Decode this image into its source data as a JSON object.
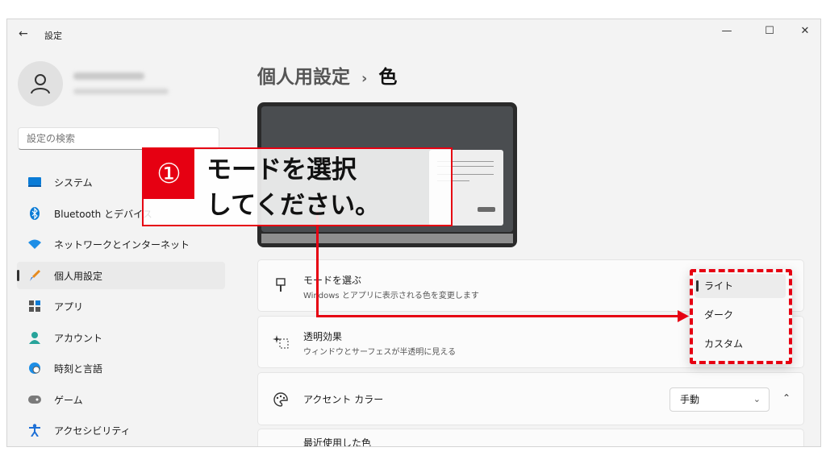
{
  "window": {
    "title": "設定",
    "back_icon": "←",
    "minimize": "—",
    "maximize": "☐",
    "close": "✕"
  },
  "user": {
    "avatar_icon": "person-icon"
  },
  "search": {
    "placeholder": "設定の検索"
  },
  "sidebar": {
    "items": [
      {
        "label": "システム",
        "icon": "monitor-icon"
      },
      {
        "label": "Bluetooth とデバイス",
        "icon": "bluetooth-icon"
      },
      {
        "label": "ネットワークとインターネット",
        "icon": "wifi-icon"
      },
      {
        "label": "個人用設定",
        "icon": "brush-icon",
        "active": true
      },
      {
        "label": "アプリ",
        "icon": "apps-icon"
      },
      {
        "label": "アカウント",
        "icon": "account-icon"
      },
      {
        "label": "時刻と言語",
        "icon": "globe-clock-icon"
      },
      {
        "label": "ゲーム",
        "icon": "gamepad-icon"
      },
      {
        "label": "アクセシビリティ",
        "icon": "accessibility-icon"
      }
    ]
  },
  "header": {
    "parent": "個人用設定",
    "separator": "›",
    "current": "色"
  },
  "mode_card": {
    "title": "モードを選ぶ",
    "description": "Windows とアプリに表示される色を変更します"
  },
  "mode_dropdown": {
    "options": [
      "ライト",
      "ダーク",
      "カスタム"
    ],
    "selected": "ライト"
  },
  "transparency_card": {
    "title": "透明効果",
    "description": "ウィンドウとサーフェスが半透明に見える"
  },
  "accent_card": {
    "title": "アクセント カラー",
    "value": "手動",
    "chevron": "⌄",
    "expander": "⌃"
  },
  "recent_colors": {
    "title": "最近使用した色"
  },
  "callout": {
    "badge": "①",
    "line1": "モードを選択",
    "line2": "してください。"
  },
  "colors": {
    "annotation": "#e60012",
    "accent_blue": "#0067c0"
  }
}
